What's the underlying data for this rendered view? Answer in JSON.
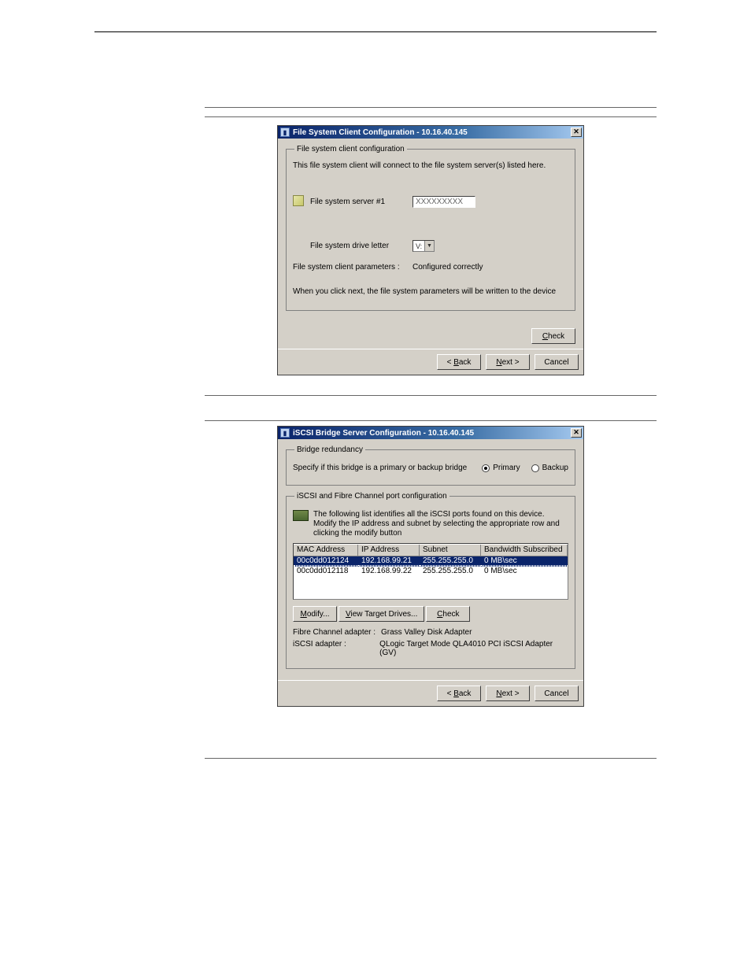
{
  "dialog1": {
    "title": "File System Client Configuration - 10.16.40.145",
    "group_title": "File system client configuration",
    "intro": "This file system client will connect to the file system server(s) listed here.",
    "fss_label": "File system server #1",
    "fss_value": "XXXXXXXXX",
    "drive_label": "File system drive letter",
    "drive_value": "V:",
    "params_label": "File system client parameters :",
    "params_value": "Configured correctly",
    "note": "When you click next, the file system parameters will be written to the device",
    "check_btn": "Check",
    "back_btn": "< Back",
    "next_btn": "Next >",
    "cancel_btn": "Cancel"
  },
  "dialog2": {
    "title": "iSCSI Bridge Server Configuration - 10.16.40.145",
    "group1_title": "Bridge redundancy",
    "redundancy_desc": "Specify if this bridge is a primary or backup bridge",
    "primary": "Primary",
    "backup": "Backup",
    "group2_title": "iSCSI and Fibre Channel port configuration",
    "iscsi_desc": "The following list identifies all the iSCSI ports found on this device. Modify the IP address and subnet by selecting the appropriate row and clicking the modify button",
    "headers": {
      "mac": "MAC Address",
      "ip": "IP Address",
      "subnet": "Subnet",
      "bw": "Bandwidth Subscribed"
    },
    "rows": [
      {
        "mac": "00c0dd012124",
        "ip": "192.168.99.21",
        "subnet": "255.255.255.0",
        "bw": "0 MB\\sec"
      },
      {
        "mac": "00c0dd012118",
        "ip": "192.168.99.22",
        "subnet": "255.255.255.0",
        "bw": "0 MB\\sec"
      }
    ],
    "modify_btn": "Modify...",
    "view_btn": "View Target Drives...",
    "check_btn": "Check",
    "fc_label": "Fibre Channel adapter :",
    "fc_value": "Grass Valley Disk Adapter",
    "iscsi_label": "iSCSI adapter :",
    "iscsi_value": "QLogic Target Mode QLA4010 PCI iSCSI Adapter (GV)",
    "back_btn": "< Back",
    "next_btn": "Next >",
    "cancel_btn": "Cancel"
  }
}
